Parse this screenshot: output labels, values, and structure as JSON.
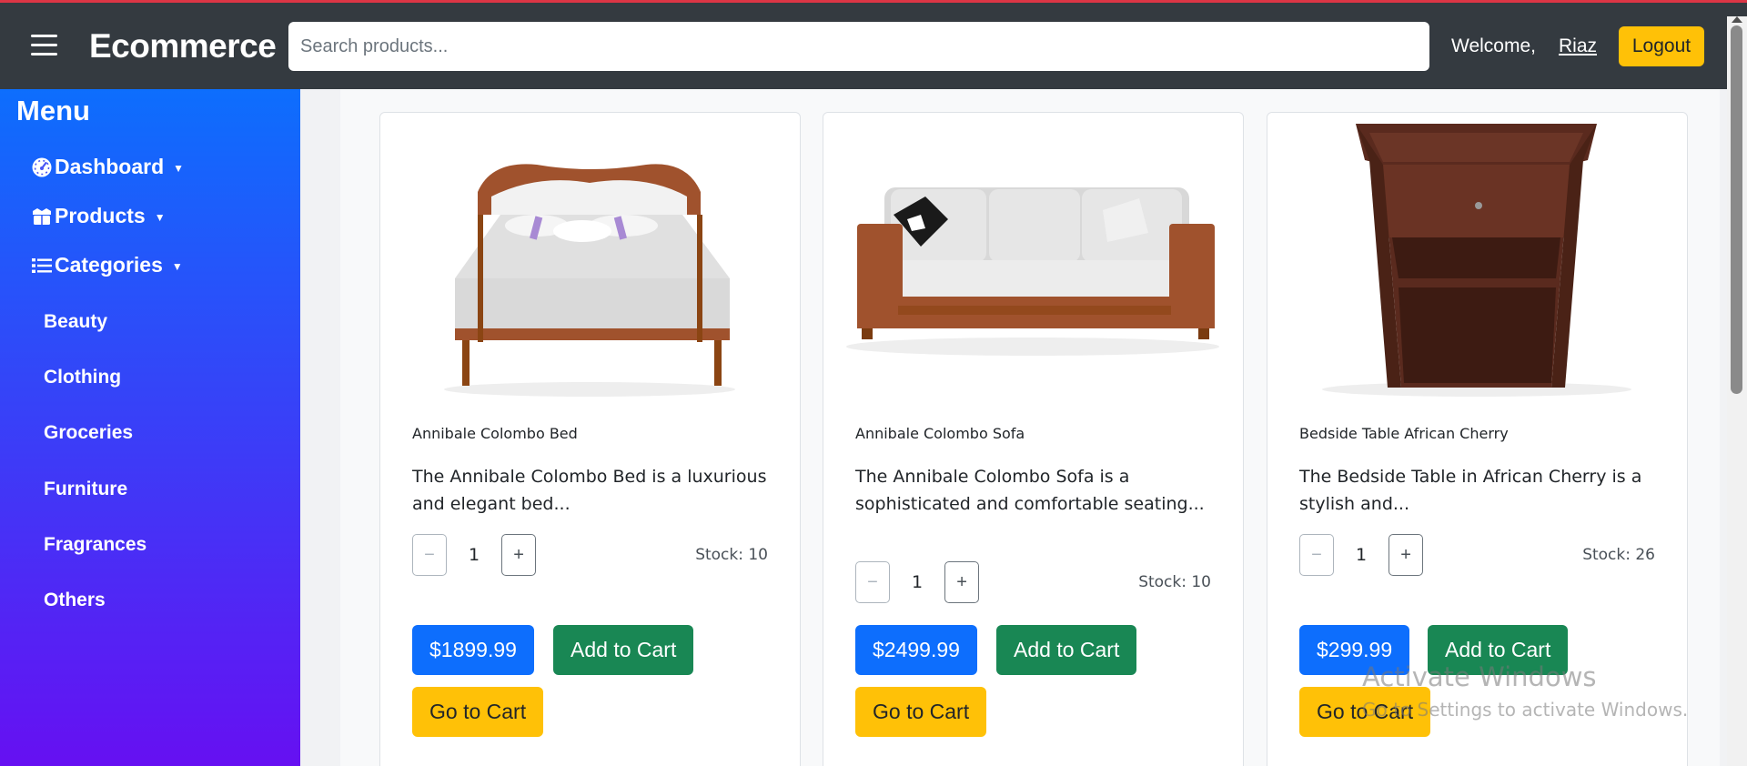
{
  "navbar": {
    "brand": "Ecommerce",
    "search_placeholder": "Search products...",
    "welcome": "Welcome,",
    "username": "Riaz",
    "logout": "Logout"
  },
  "sidebar": {
    "title": "Menu",
    "items": [
      {
        "label": "Dashboard",
        "icon": "dashboard-gauge-icon"
      },
      {
        "label": "Products",
        "icon": "boxes-icon"
      },
      {
        "label": "Categories",
        "icon": "list-icon"
      }
    ],
    "categories": [
      "Beauty",
      "Clothing",
      "Groceries",
      "Furniture",
      "Fragrances",
      "Others"
    ]
  },
  "products": [
    {
      "name": "Annibale Colombo Bed",
      "description": "The Annibale Colombo Bed is a luxurious and elegant bed...",
      "quantity": "1",
      "stock": "Stock: 10",
      "price": "$1899.99",
      "add_label": "Add to Cart",
      "go_label": "Go to Cart",
      "image": "bed-image"
    },
    {
      "name": "Annibale Colombo Sofa",
      "description": "The Annibale Colombo Sofa is a sophisticated and comfortable seating...",
      "quantity": "1",
      "stock": "Stock: 10",
      "price": "$2499.99",
      "add_label": "Add to Cart",
      "go_label": "Go to Cart",
      "image": "sofa-image"
    },
    {
      "name": "Bedside Table African Cherry",
      "description": "The Bedside Table in African Cherry is a stylish and...",
      "quantity": "1",
      "stock": "Stock: 26",
      "price": "$299.99",
      "add_label": "Add to Cart",
      "go_label": "Go to Cart",
      "image": "bedside-table-image"
    }
  ],
  "watermark": {
    "line1": "Activate Windows",
    "line2": "Go to Settings to activate Windows."
  },
  "colors": {
    "navbar": "#343a40",
    "sidebar_top": "#0d6efd",
    "sidebar_bottom": "#6610f2",
    "primary": "#0d6efd",
    "success": "#198754",
    "warning": "#ffc107"
  }
}
